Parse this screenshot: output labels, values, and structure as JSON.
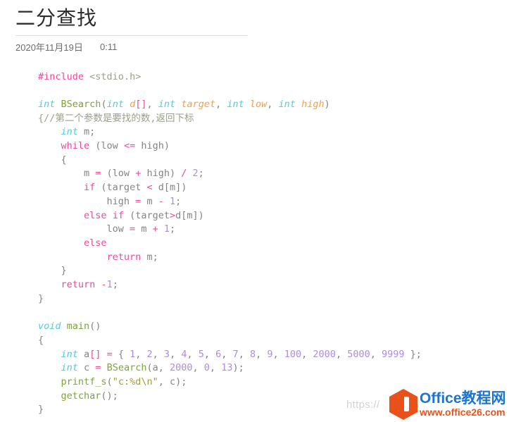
{
  "document": {
    "title": "二分查找",
    "date": "2020年11月19日",
    "time": "0:11"
  },
  "code": {
    "language": "c",
    "lines": [
      [
        {
          "text": "#include",
          "token": "pre"
        },
        {
          "text": " ",
          "token": "id"
        },
        {
          "text": "<stdio.h>",
          "token": "hdr"
        }
      ],
      [],
      [
        {
          "text": "int",
          "token": "type"
        },
        {
          "text": " ",
          "token": "id"
        },
        {
          "text": "BSearch",
          "token": "fn"
        },
        {
          "text": "(",
          "token": "id"
        },
        {
          "text": "int",
          "token": "type"
        },
        {
          "text": " ",
          "token": "id"
        },
        {
          "text": "d",
          "token": "param"
        },
        {
          "text": "[]",
          "token": "op"
        },
        {
          "text": ", ",
          "token": "id"
        },
        {
          "text": "int",
          "token": "type"
        },
        {
          "text": " ",
          "token": "id"
        },
        {
          "text": "target",
          "token": "param"
        },
        {
          "text": ", ",
          "token": "id"
        },
        {
          "text": "int",
          "token": "type"
        },
        {
          "text": " ",
          "token": "id"
        },
        {
          "text": "low",
          "token": "param"
        },
        {
          "text": ", ",
          "token": "id"
        },
        {
          "text": "int",
          "token": "type"
        },
        {
          "text": " ",
          "token": "id"
        },
        {
          "text": "high",
          "token": "param"
        },
        {
          "text": ")",
          "token": "id"
        }
      ],
      [
        {
          "text": "{//第二个参数是要找的数,返回下标",
          "token": "cmt"
        }
      ],
      [
        {
          "text": "    ",
          "token": "id"
        },
        {
          "text": "int",
          "token": "type"
        },
        {
          "text": " m;",
          "token": "id"
        }
      ],
      [
        {
          "text": "    ",
          "token": "id"
        },
        {
          "text": "while",
          "token": "kw"
        },
        {
          "text": " (low ",
          "token": "id"
        },
        {
          "text": "<=",
          "token": "op"
        },
        {
          "text": " high)",
          "token": "id"
        }
      ],
      [
        {
          "text": "    {",
          "token": "id"
        }
      ],
      [
        {
          "text": "        m ",
          "token": "id"
        },
        {
          "text": "=",
          "token": "op"
        },
        {
          "text": " (low ",
          "token": "id"
        },
        {
          "text": "+",
          "token": "op"
        },
        {
          "text": " high) ",
          "token": "id"
        },
        {
          "text": "/",
          "token": "op"
        },
        {
          "text": " ",
          "token": "id"
        },
        {
          "text": "2",
          "token": "num"
        },
        {
          "text": ";",
          "token": "id"
        }
      ],
      [
        {
          "text": "        ",
          "token": "id"
        },
        {
          "text": "if",
          "token": "kw"
        },
        {
          "text": " (target ",
          "token": "id"
        },
        {
          "text": "<",
          "token": "op"
        },
        {
          "text": " d[m])",
          "token": "id"
        }
      ],
      [
        {
          "text": "            high ",
          "token": "id"
        },
        {
          "text": "=",
          "token": "op"
        },
        {
          "text": " m ",
          "token": "id"
        },
        {
          "text": "-",
          "token": "op"
        },
        {
          "text": " ",
          "token": "id"
        },
        {
          "text": "1",
          "token": "num"
        },
        {
          "text": ";",
          "token": "id"
        }
      ],
      [
        {
          "text": "        ",
          "token": "id"
        },
        {
          "text": "else",
          "token": "kw"
        },
        {
          "text": " ",
          "token": "id"
        },
        {
          "text": "if",
          "token": "kw"
        },
        {
          "text": " (target",
          "token": "id"
        },
        {
          "text": ">",
          "token": "op"
        },
        {
          "text": "d[m])",
          "token": "id"
        }
      ],
      [
        {
          "text": "            low ",
          "token": "id"
        },
        {
          "text": "=",
          "token": "op"
        },
        {
          "text": " m ",
          "token": "id"
        },
        {
          "text": "+",
          "token": "op"
        },
        {
          "text": " ",
          "token": "id"
        },
        {
          "text": "1",
          "token": "num"
        },
        {
          "text": ";",
          "token": "id"
        }
      ],
      [
        {
          "text": "        ",
          "token": "id"
        },
        {
          "text": "else",
          "token": "kw"
        }
      ],
      [
        {
          "text": "            ",
          "token": "id"
        },
        {
          "text": "return",
          "token": "kw"
        },
        {
          "text": " m;",
          "token": "id"
        }
      ],
      [
        {
          "text": "    }",
          "token": "id"
        }
      ],
      [
        {
          "text": "    ",
          "token": "id"
        },
        {
          "text": "return",
          "token": "kw"
        },
        {
          "text": " ",
          "token": "id"
        },
        {
          "text": "-",
          "token": "op"
        },
        {
          "text": "1",
          "token": "num"
        },
        {
          "text": ";",
          "token": "id"
        }
      ],
      [
        {
          "text": "}",
          "token": "id"
        }
      ],
      [],
      [
        {
          "text": "void",
          "token": "type"
        },
        {
          "text": " ",
          "token": "id"
        },
        {
          "text": "main",
          "token": "fn"
        },
        {
          "text": "()",
          "token": "id"
        }
      ],
      [
        {
          "text": "{",
          "token": "id"
        }
      ],
      [
        {
          "text": "    ",
          "token": "id"
        },
        {
          "text": "int",
          "token": "type"
        },
        {
          "text": " a",
          "token": "id"
        },
        {
          "text": "[]",
          "token": "op"
        },
        {
          "text": " ",
          "token": "id"
        },
        {
          "text": "=",
          "token": "op"
        },
        {
          "text": " { ",
          "token": "id"
        },
        {
          "text": "1",
          "token": "num"
        },
        {
          "text": ", ",
          "token": "id"
        },
        {
          "text": "2",
          "token": "num"
        },
        {
          "text": ", ",
          "token": "id"
        },
        {
          "text": "3",
          "token": "num"
        },
        {
          "text": ", ",
          "token": "id"
        },
        {
          "text": "4",
          "token": "num"
        },
        {
          "text": ", ",
          "token": "id"
        },
        {
          "text": "5",
          "token": "num"
        },
        {
          "text": ", ",
          "token": "id"
        },
        {
          "text": "6",
          "token": "num"
        },
        {
          "text": ", ",
          "token": "id"
        },
        {
          "text": "7",
          "token": "num"
        },
        {
          "text": ", ",
          "token": "id"
        },
        {
          "text": "8",
          "token": "num"
        },
        {
          "text": ", ",
          "token": "id"
        },
        {
          "text": "9",
          "token": "num"
        },
        {
          "text": ", ",
          "token": "id"
        },
        {
          "text": "100",
          "token": "num"
        },
        {
          "text": ", ",
          "token": "id"
        },
        {
          "text": "2000",
          "token": "num"
        },
        {
          "text": ", ",
          "token": "id"
        },
        {
          "text": "5000",
          "token": "num"
        },
        {
          "text": ", ",
          "token": "id"
        },
        {
          "text": "9999",
          "token": "num"
        },
        {
          "text": " };",
          "token": "id"
        }
      ],
      [
        {
          "text": "    ",
          "token": "id"
        },
        {
          "text": "int",
          "token": "type"
        },
        {
          "text": " c ",
          "token": "id"
        },
        {
          "text": "=",
          "token": "op"
        },
        {
          "text": " ",
          "token": "id"
        },
        {
          "text": "BSearch",
          "token": "fn"
        },
        {
          "text": "(a, ",
          "token": "id"
        },
        {
          "text": "2000",
          "token": "num"
        },
        {
          "text": ", ",
          "token": "id"
        },
        {
          "text": "0",
          "token": "num"
        },
        {
          "text": ", ",
          "token": "id"
        },
        {
          "text": "13",
          "token": "num"
        },
        {
          "text": ");",
          "token": "id"
        }
      ],
      [
        {
          "text": "    ",
          "token": "id"
        },
        {
          "text": "printf_s",
          "token": "fn"
        },
        {
          "text": "(",
          "token": "id"
        },
        {
          "text": "\"c:%d\\n\"",
          "token": "str"
        },
        {
          "text": ", c);",
          "token": "id"
        }
      ],
      [
        {
          "text": "    ",
          "token": "id"
        },
        {
          "text": "getchar",
          "token": "fn"
        },
        {
          "text": "();",
          "token": "id"
        }
      ],
      [
        {
          "text": "}",
          "token": "id"
        }
      ]
    ]
  },
  "watermark": {
    "url_text": "https://",
    "logo_name": "Office教程网",
    "logo_url": "www.office26.com",
    "logo_icon": "office-hexagon-icon",
    "brand_orange": "#e8521a",
    "brand_blue": "#1b75d1"
  }
}
